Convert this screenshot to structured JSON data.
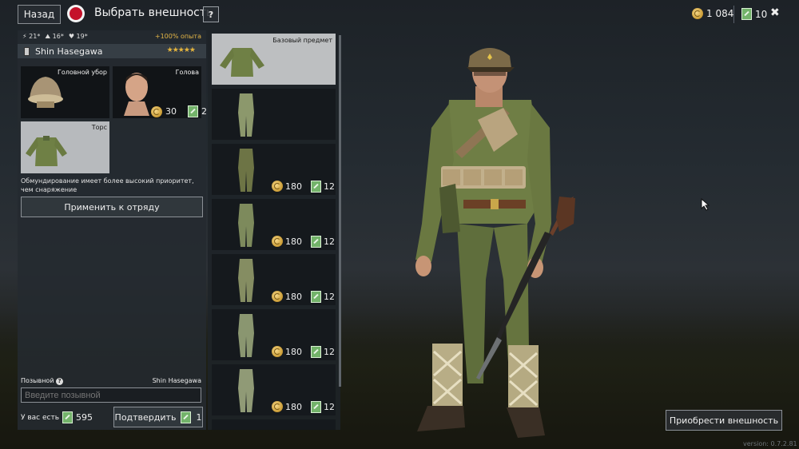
{
  "header": {
    "back_label": "Назад",
    "title": "Выбрать внешность",
    "help_label": "?",
    "silver": "1 084",
    "tickets": "10",
    "close_label": "✖"
  },
  "soldier": {
    "stats": [
      "21",
      "16",
      "19"
    ],
    "bonus": "+100% опыта",
    "name": "Shin Hasegawa",
    "stars": "★★★★★"
  },
  "slots": {
    "headwear": {
      "label": "Головной убор"
    },
    "head": {
      "label": "Голова",
      "price_silver": "30",
      "price_tickets": "2"
    },
    "torso": {
      "label": "Торс"
    }
  },
  "priority_note": "Обмундирование имеет более высокий приоритет, чем снаряжение",
  "apply_label": "Применить к отряду",
  "callsign": {
    "label": "Позывной",
    "help": "?",
    "current_name": "Shin Hasegawa",
    "placeholder": "Введите позывной",
    "have_label": "У вас есть",
    "have_tickets": "595",
    "confirm_label": "Подтвердить",
    "confirm_tickets": "1"
  },
  "items": [
    {
      "label": "Базовый предмет",
      "silver": "",
      "tickets": ""
    },
    {
      "label": "",
      "silver": "",
      "tickets": ""
    },
    {
      "label": "",
      "silver": "180",
      "tickets": "12"
    },
    {
      "label": "",
      "silver": "180",
      "tickets": "12"
    },
    {
      "label": "",
      "silver": "180",
      "tickets": "12"
    },
    {
      "label": "",
      "silver": "180",
      "tickets": "12"
    },
    {
      "label": "",
      "silver": "180",
      "tickets": "12"
    }
  ],
  "buy_label": "Приобрести внешность",
  "version": "version: 0.7.2.81",
  "colors": {
    "accent_red": "#c4122a",
    "gold": "#e5b53d",
    "ticket_green": "#73b36a"
  }
}
